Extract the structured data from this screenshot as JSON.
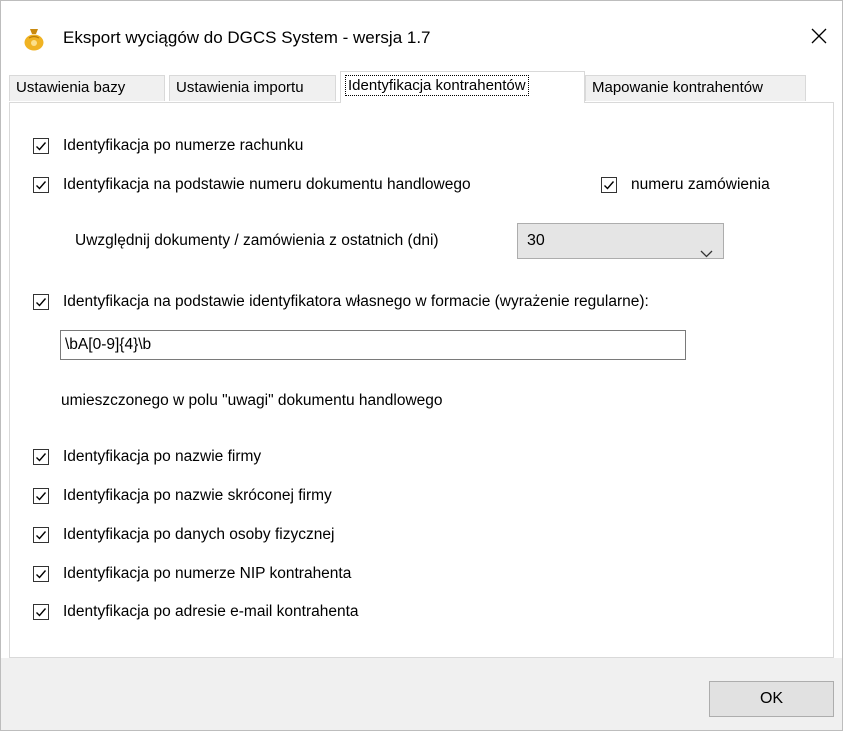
{
  "window": {
    "title": "Eksport wyciągów do DGCS System - wersja 1.7",
    "app_icon": "money-bag-icon",
    "close_icon": "close-icon"
  },
  "tabs": [
    {
      "label": "Ustawienia bazy",
      "active": false
    },
    {
      "label": "Ustawienia importu",
      "active": false
    },
    {
      "label": "Identyfikacja kontrahentów",
      "active": true
    },
    {
      "label": "Mapowanie kontrahentów",
      "active": false
    }
  ],
  "options": {
    "by_account_number": {
      "label": "Identyfikacja po numerze rachunku",
      "checked": true
    },
    "by_trade_document": {
      "label": "Identyfikacja na podstawie numeru dokumentu handlowego",
      "checked": true
    },
    "by_order_number": {
      "label": "numeru zamówienia",
      "checked": true
    },
    "days_label": "Uwzględnij dokumenty / zamówienia z ostatnich (dni)",
    "days_value": "30",
    "by_own_identifier": {
      "label": "Identyfikacja na podstawie identyfikatora własnego w formacie (wyrażenie regularne):",
      "checked": true
    },
    "regex_value": "\\bA[0-9]{4}\\b",
    "regex_note": "umieszczonego w polu \"uwagi\" dokumentu handlowego",
    "by_company_name": {
      "label": "Identyfikacja po nazwie firmy",
      "checked": true
    },
    "by_short_name": {
      "label": "Identyfikacja po nazwie skróconej firmy",
      "checked": true
    },
    "by_person_data": {
      "label": "Identyfikacja po danych osoby fizycznej",
      "checked": true
    },
    "by_nip": {
      "label": "Identyfikacja po numerze NIP kontrahenta",
      "checked": true
    },
    "by_email": {
      "label": "Identyfikacja po adresie e-mail kontrahenta",
      "checked": true
    }
  },
  "footer": {
    "ok_label": "OK"
  },
  "colors": {
    "accent": "#e8a317",
    "tab_bg": "#f0f0f0",
    "button_bg": "#e1e1e1"
  }
}
